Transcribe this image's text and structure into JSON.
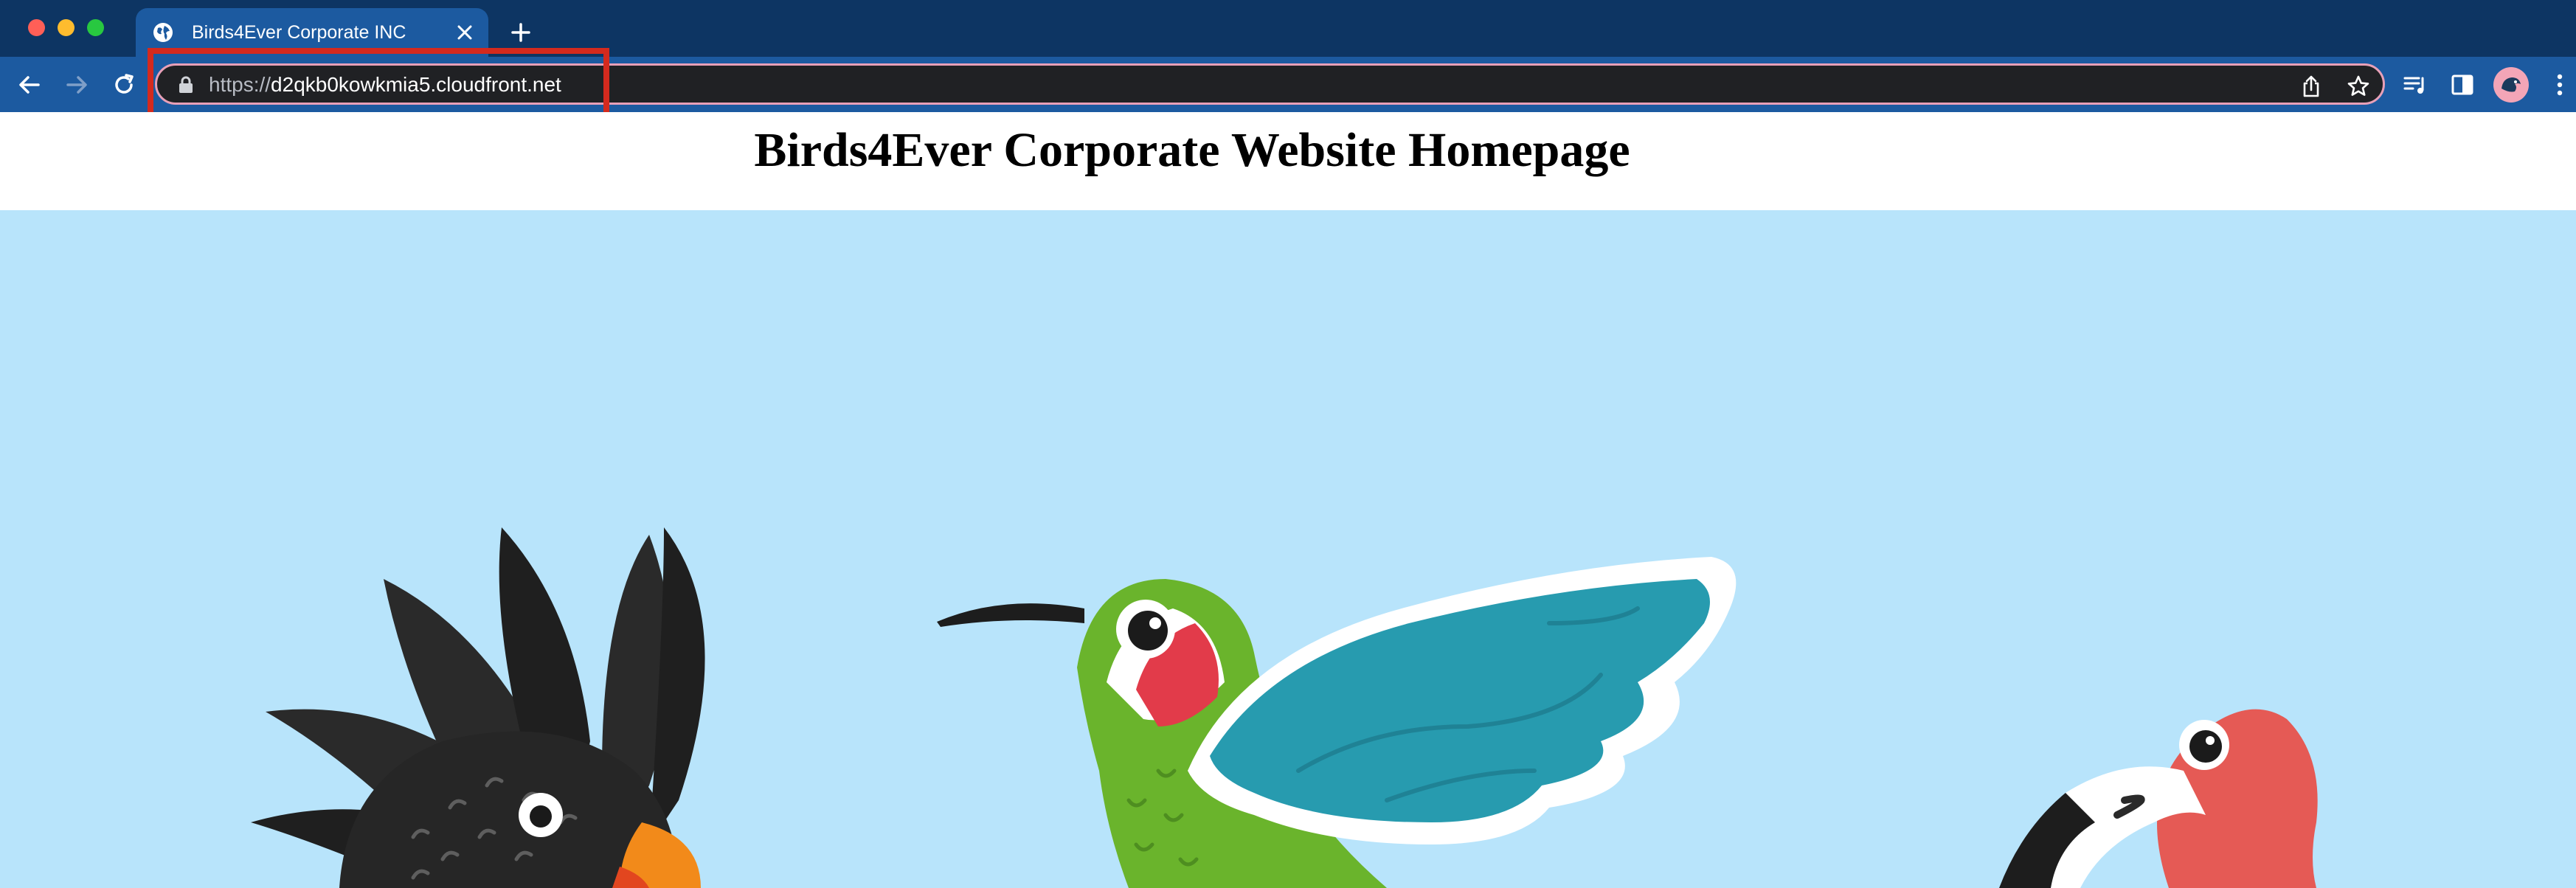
{
  "browser": {
    "tab": {
      "title": "Birds4Ever Corporate INC",
      "icon": "globe-icon"
    },
    "new_tab_icon": "plus-icon",
    "address_bar": {
      "scheme": "https://",
      "host": "d2qkb0kowkmia5.cloudfront.net"
    },
    "toolbar_icons": [
      "back-arrow-icon",
      "forward-arrow-icon",
      "reload-icon",
      "lock-icon",
      "share-icon",
      "star-icon",
      "reading-list-icon",
      "side-panel-icon",
      "profile-avatar-icon",
      "more-menu-icon"
    ]
  },
  "page": {
    "heading": "Birds4Ever Corporate Website Homepage",
    "hero_image": {
      "subjects": [
        "cockatoo",
        "hummingbird",
        "flamingo"
      ]
    }
  },
  "colors": {
    "tab_strip": "#0d3563",
    "toolbar": "#1c5aa0",
    "omnibox": "#202124",
    "highlight": "#d42a1e",
    "hero_background": "#b8e4fb"
  }
}
